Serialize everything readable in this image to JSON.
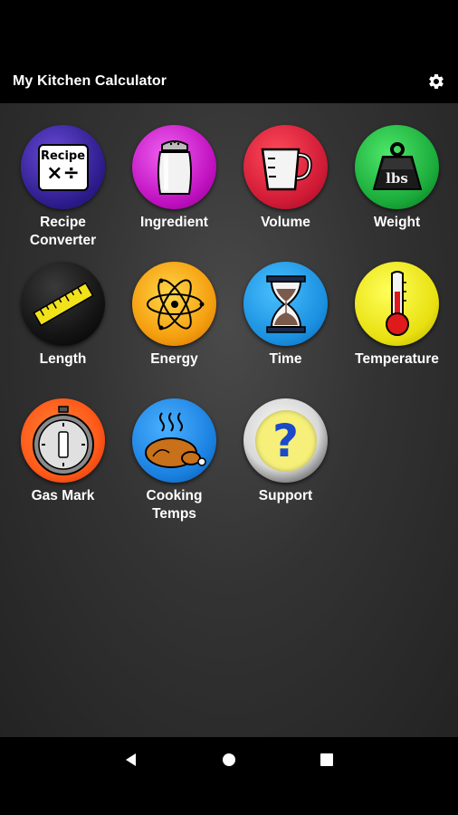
{
  "app_bar": {
    "title": "My Kitchen Calculator",
    "settings_icon": "gear-icon"
  },
  "tiles": [
    {
      "label": "Recipe\nConverter",
      "icon": "recipe-converter-icon",
      "color": "#3a2a9a"
    },
    {
      "label": "Ingredient",
      "icon": "salt-shaker-icon",
      "color": "#d21fd2"
    },
    {
      "label": "Volume",
      "icon": "measuring-cup-icon",
      "color": "#d8203a"
    },
    {
      "label": "Weight",
      "icon": "weight-lbs-icon",
      "color": "#21b84a"
    },
    {
      "label": "Length",
      "icon": "ruler-icon",
      "color": "#111111"
    },
    {
      "label": "Energy",
      "icon": "atom-icon",
      "color": "#f5a010"
    },
    {
      "label": "Time",
      "icon": "hourglass-icon",
      "color": "#1a9be0"
    },
    {
      "label": "Temperature",
      "icon": "thermometer-icon",
      "color": "#e8e010"
    },
    {
      "label": "Gas Mark",
      "icon": "stopwatch-icon",
      "color": "#ff5a1a"
    },
    {
      "label": "Cooking\nTemps",
      "icon": "roast-chicken-icon",
      "color": "#1f8de8"
    },
    {
      "label": "Support",
      "icon": "question-mark-icon",
      "color": "#ffffff"
    }
  ],
  "recipe_icon_text": "Recipe",
  "recipe_icon_symbols": "×÷",
  "weight_icon_text": "lbs",
  "support_icon_text": "?",
  "nav": {
    "back_icon": "back-icon",
    "home_icon": "home-icon",
    "recents_icon": "recents-icon"
  }
}
